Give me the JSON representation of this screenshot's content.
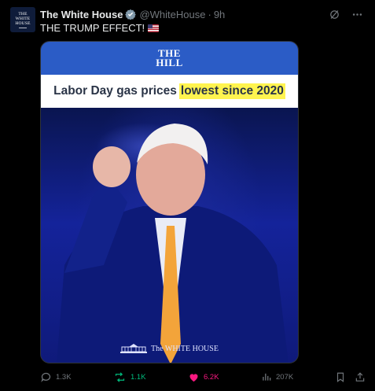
{
  "post": {
    "author_name": "The White House",
    "handle": "@WhiteHouse",
    "separator": "·",
    "timestamp": "9h",
    "text": "THE TRUMP EFFECT!",
    "text_emoji": "us-flag-icon"
  },
  "avatar": {
    "line1": "THE",
    "line2": "WHITE",
    "line3": "HOUSE"
  },
  "media": {
    "outlet_line1": "THE",
    "outlet_line2": "HILL",
    "headline": "Labor Day gas prices",
    "headline_highlight": "lowest since 2020",
    "footer_text": "The WHITE HOUSE",
    "colors": {
      "outlet_blue": "#2b5cc6",
      "highlight": "#fff44f",
      "photo_blue": "#14239a"
    }
  },
  "actions": {
    "replies": "1.3K",
    "reposts": "1.1K",
    "likes": "6.2K",
    "views": "207K"
  },
  "colors": {
    "repost_green": "#00ba7c",
    "like_pink": "#f91880",
    "muted": "#71767b",
    "verified_gray": "#829aab"
  }
}
